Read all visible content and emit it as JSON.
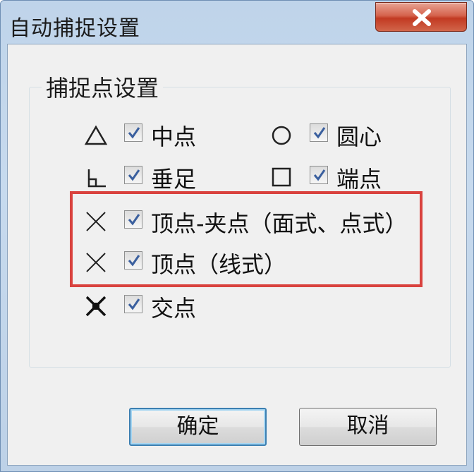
{
  "window": {
    "title": "自动捕捉设置"
  },
  "group": {
    "title": "捕捉点设置"
  },
  "options": [
    {
      "label": "中点",
      "checked": true,
      "symbol": "triangle-icon"
    },
    {
      "label": "圆心",
      "checked": true,
      "symbol": "circle-icon"
    },
    {
      "label": "垂足",
      "checked": true,
      "symbol": "perpendicular-icon"
    },
    {
      "label": "端点",
      "checked": true,
      "symbol": "square-icon"
    },
    {
      "label": "顶点-夹点（面式、点式）",
      "checked": true,
      "symbol": "x-cross-icon"
    },
    {
      "label": "顶点（线式）",
      "checked": true,
      "symbol": "x-cross-icon"
    },
    {
      "label": "交点",
      "checked": true,
      "symbol": "intersection-icon"
    }
  ],
  "buttons": {
    "ok": "确定",
    "cancel": "取消"
  },
  "colors": {
    "highlight": "#d9423e",
    "close": "#c23a22",
    "accent": "#3c7fb1"
  }
}
